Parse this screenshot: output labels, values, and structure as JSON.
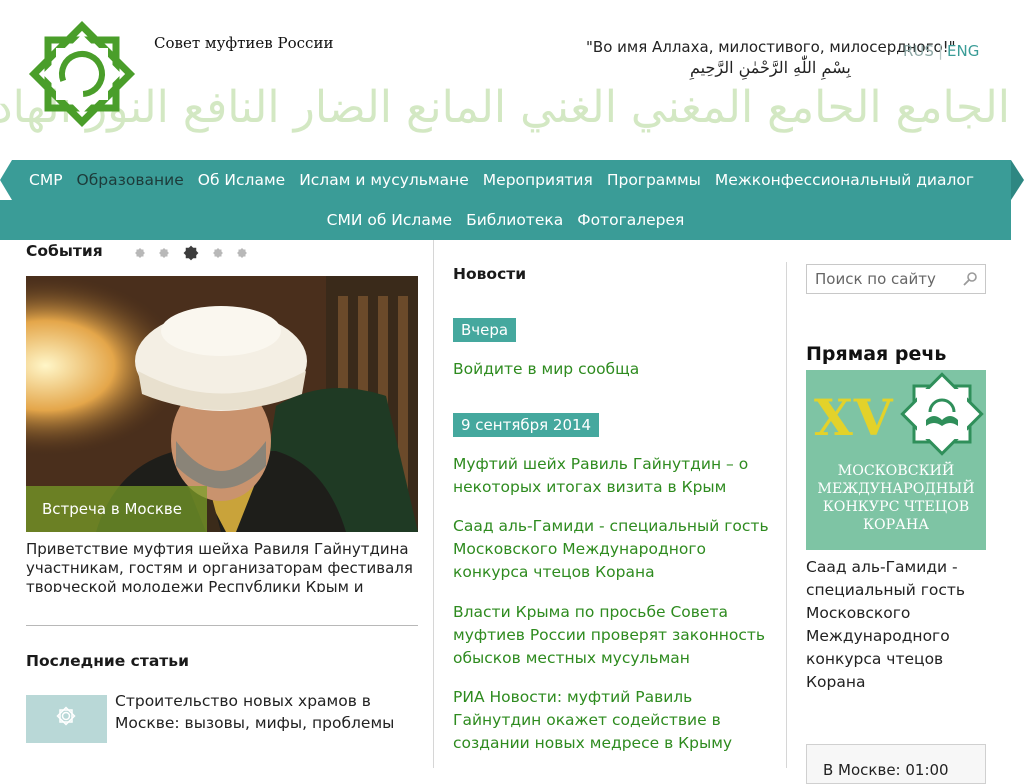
{
  "header": {
    "site_name": "Совет муфтиев России",
    "basmala_ru": "\"Во имя Аллаха, милостивого, милосердного!\"",
    "basmala_ar": "بِسْمِ اللّٰهِ الرَّحْمٰنِ الرَّحِيمِ",
    "calligraphy": "الجامع الحامع المغني الغني المانع الضار النافع النور الهادي البديع الباقي الوارث",
    "lang_ru": "RUS",
    "lang_sep": "|",
    "lang_en": "ENG"
  },
  "nav": {
    "row1": [
      "СМР",
      "Образование",
      "Об Исламе",
      "Ислам и мусульмане",
      "Мероприятия",
      "Программы",
      "Межконфессиональный диалог"
    ],
    "row2": [
      "СМИ об Исламе",
      "Библиотека",
      "Фотогалерея"
    ],
    "active": "Образование"
  },
  "events": {
    "heading": "События",
    "slide_count": 5,
    "active_slide": 3,
    "caption": "Встреча в Москве",
    "text": "Приветствие муфтия шейха Равиля Гайнутдина участникам, гостям и организаторам фестиваля творческой молодежи Республики Крым и"
  },
  "articles": {
    "heading": "Последние статьи",
    "items": [
      {
        "title": "Строительство новых храмов в Москве: вызовы, мифы, проблемы"
      }
    ]
  },
  "news": {
    "heading": "Новости",
    "groups": [
      {
        "date": "Вчера",
        "items": [
          "Войдите в мир сообща"
        ]
      },
      {
        "date": "9 сентября 2014",
        "items": [
          "Муфтий шейх Равиль Гайнутдин – о некоторых итогах визита в Крым",
          "Саад аль-Гамиди - специальный гость Московского Международного конкурса чтецов Корана",
          "Власти Крыма по просьбе Совета муфтиев России проверят законность обысков местных мусульман",
          "РИА Новости: муфтий Равиль Гайнутдин окажет содействие в создании новых медресе в Крыму"
        ]
      }
    ]
  },
  "sidebar": {
    "search_placeholder": "Поиск по сайту",
    "speech_heading": "Прямая речь",
    "banner_numeral": "XV",
    "banner_text": "МОСКОВСКИЙ МЕЖДУНАРОДНЫЙ КОНКУРС ЧТЕЦОВ КОРАНА",
    "speech_text": "Саад аль-Гамиди - специальный гость Московского Международного конкурса чтецов Корана",
    "time_text": "В Москве: 01:00"
  },
  "colors": {
    "nav_teal": "#3a9c97",
    "news_link": "#2e8b1f",
    "date_badge": "#45a89e",
    "logo_green": "#4a9e2a"
  }
}
